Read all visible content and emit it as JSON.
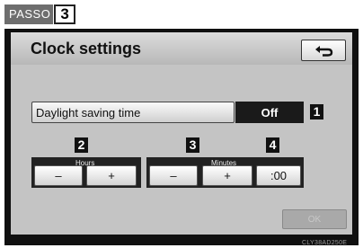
{
  "tag": {
    "brand": "PASSO",
    "number": "3"
  },
  "screen": {
    "title": "Clock settings",
    "daylight_saving": {
      "label": "Daylight saving time",
      "value": "Off"
    },
    "hours": {
      "label": "Hours",
      "minus": "–",
      "plus": "+"
    },
    "minutes": {
      "label": "Minutes",
      "minus": "–",
      "plus": "+"
    },
    "reset_label": ":00",
    "ok_label": "OK"
  },
  "callouts": {
    "c1": "1",
    "c2": "2",
    "c3": "3",
    "c4": "4"
  },
  "image_code": "CLY38AD250E",
  "icons": {
    "back": "back-arrow-icon"
  }
}
